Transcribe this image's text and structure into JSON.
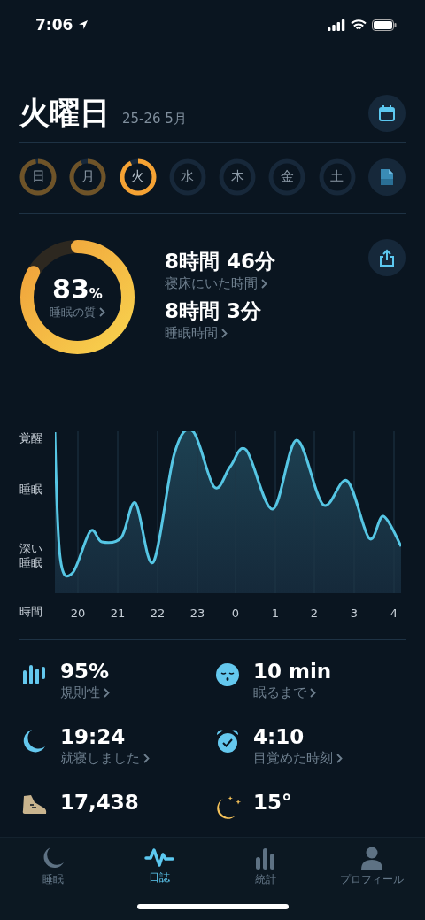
{
  "status_bar": {
    "time": "7:06"
  },
  "header": {
    "title": "火曜日",
    "date_range": "25-26 5月"
  },
  "days": [
    {
      "label": "日",
      "recorded": true,
      "selected": false
    },
    {
      "label": "月",
      "recorded": true,
      "selected": false
    },
    {
      "label": "火",
      "recorded": true,
      "selected": true
    },
    {
      "label": "水",
      "recorded": false,
      "selected": false
    },
    {
      "label": "木",
      "recorded": false,
      "selected": false
    },
    {
      "label": "金",
      "recorded": false,
      "selected": false
    },
    {
      "label": "土",
      "recorded": false,
      "selected": false
    }
  ],
  "summary": {
    "quality": {
      "value": "83",
      "unit": "%",
      "label": "睡眠の質"
    },
    "metrics": [
      {
        "value": "8時間 46分",
        "label": "寝床にいた時間"
      },
      {
        "value": "8時間 3分",
        "label": "睡眠時間"
      }
    ]
  },
  "chart": {
    "y_labels": [
      "覚醒",
      "睡眠",
      "深い睡眠"
    ],
    "x_axis_title": "時間",
    "x_labels": [
      "20",
      "21",
      "22",
      "23",
      "0",
      "1",
      "2",
      "3",
      "4"
    ]
  },
  "stats": [
    {
      "kind": "regularity",
      "value": "95%",
      "label": "規則性"
    },
    {
      "kind": "fall_asleep",
      "value": "10 min",
      "label": "眠るまで"
    },
    {
      "kind": "bedtime",
      "value": "19:24",
      "label": "就寝しました"
    },
    {
      "kind": "wake",
      "value": "4:10",
      "label": "目覚めた時刻"
    },
    {
      "kind": "steps",
      "value": "17,438"
    },
    {
      "kind": "weather",
      "value": "15°"
    }
  ],
  "tabs": [
    {
      "kind": "sleep",
      "label": "睡眠",
      "selected": false
    },
    {
      "kind": "journal",
      "label": "日誌",
      "selected": true
    },
    {
      "kind": "stats",
      "label": "統計",
      "selected": false
    },
    {
      "kind": "profile",
      "label": "プロフィール",
      "selected": false
    }
  ]
}
